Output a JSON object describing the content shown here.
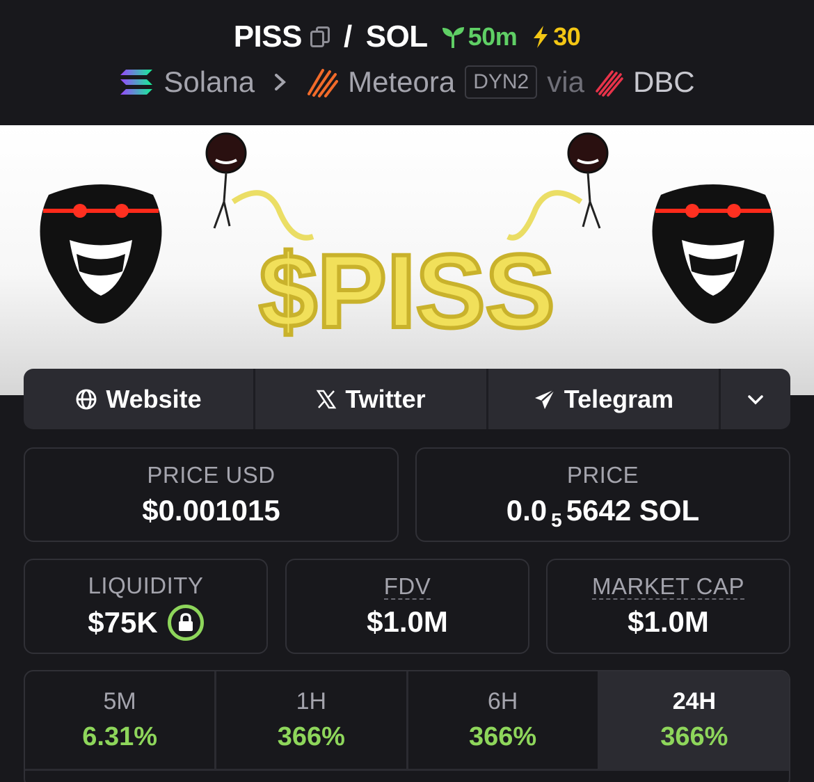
{
  "header": {
    "base_symbol": "PISS",
    "slash": "/",
    "quote_symbol": "SOL",
    "age": "50m",
    "boosts": "30",
    "chain": "Solana",
    "dex": "Meteora",
    "dex_badge": "DYN2",
    "via": "via",
    "launchpad": "DBC"
  },
  "banner": {
    "text": "$PISS"
  },
  "links": {
    "website": "Website",
    "twitter": "Twitter",
    "telegram": "Telegram"
  },
  "stats": {
    "price_usd_label": "PRICE USD",
    "price_usd": "$0.001015",
    "price_label": "PRICE",
    "price_prefix": "0.0",
    "price_zeros": "5",
    "price_rest": "5642 SOL",
    "liquidity_label": "LIQUIDITY",
    "liquidity": "$75K",
    "fdv_label": "FDV",
    "fdv": "$1.0M",
    "mcap_label": "MARKET CAP",
    "mcap": "$1.0M"
  },
  "timeframes": [
    {
      "label": "5M",
      "change": "6.31%"
    },
    {
      "label": "1H",
      "change": "366%"
    },
    {
      "label": "6H",
      "change": "366%"
    },
    {
      "label": "24H",
      "change": "366%"
    }
  ],
  "colors": {
    "background": "#18181c",
    "positive": "#8ed65b",
    "age_green": "#5fcf65",
    "boost_yellow": "#f3c614"
  },
  "icons": [
    "copy-icon",
    "seedling-icon",
    "lightning-icon",
    "solana-logo",
    "meteora-logo",
    "dbc-logo",
    "globe-icon",
    "x-icon",
    "telegram-icon",
    "chevron-down-icon",
    "lock-icon"
  ]
}
